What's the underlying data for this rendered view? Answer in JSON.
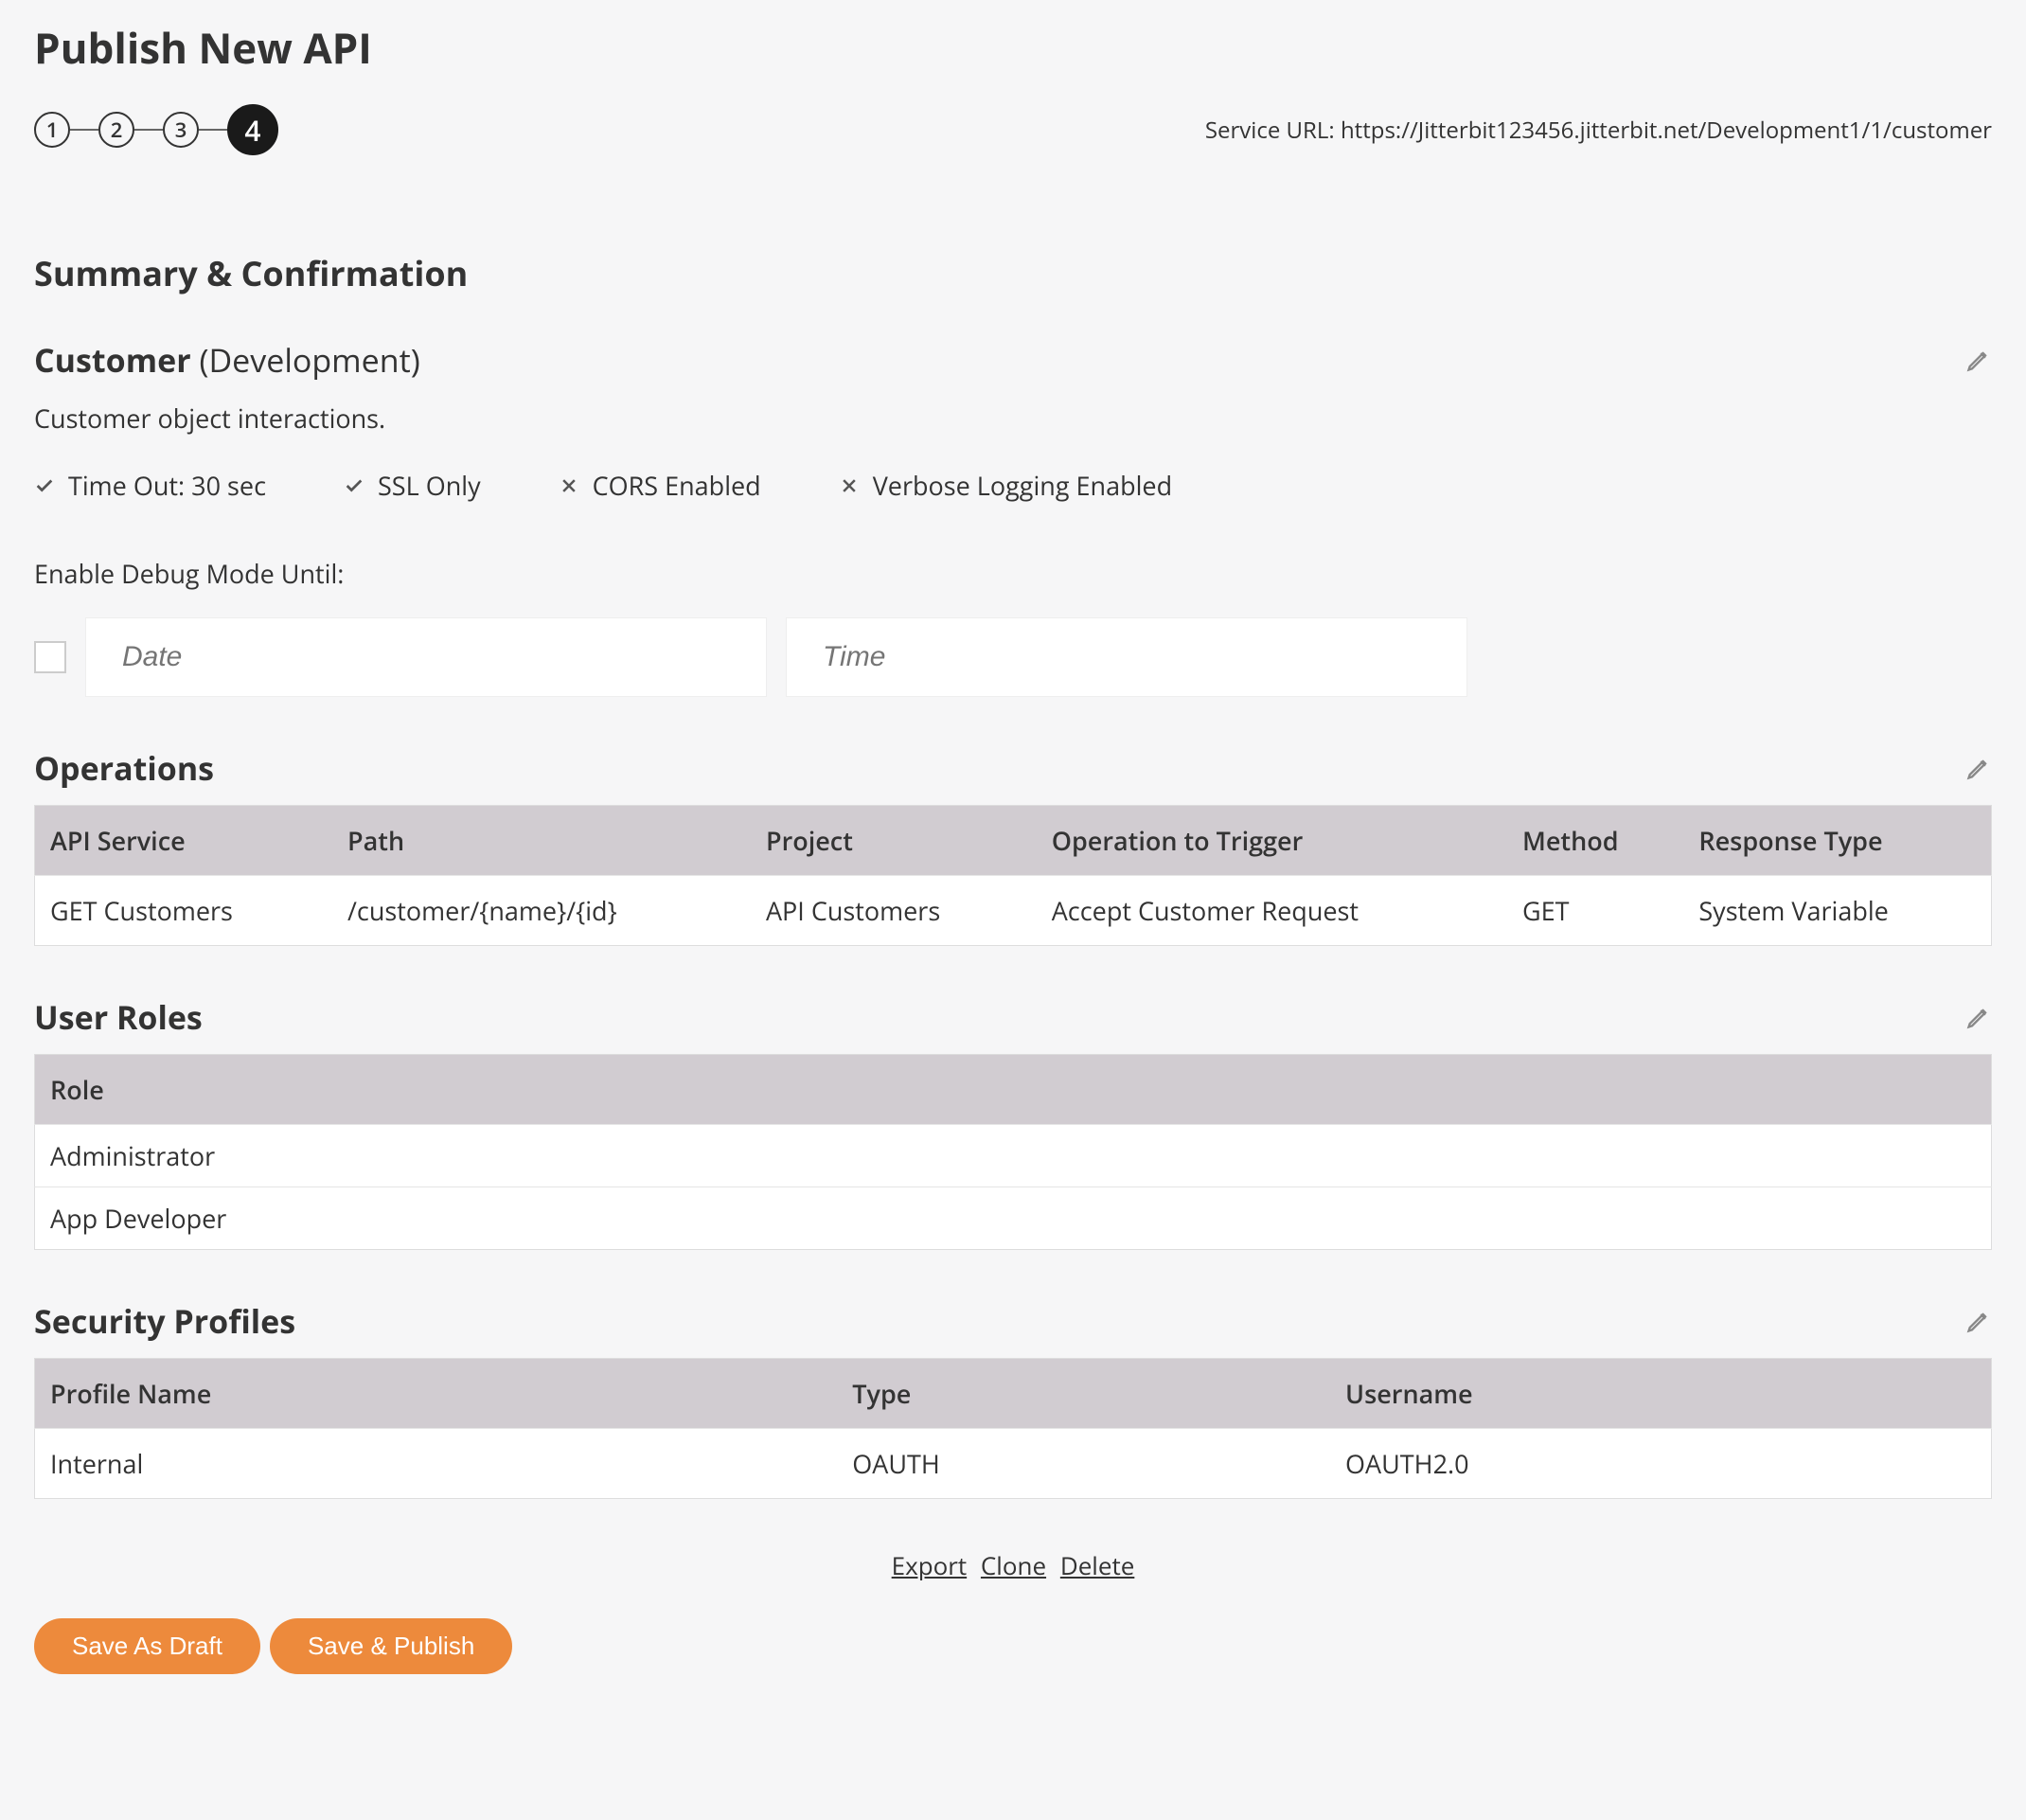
{
  "page_title": "Publish New API",
  "stepper": {
    "steps": [
      "1",
      "2",
      "3",
      "4"
    ],
    "active": 4
  },
  "service_url_label": "Service URL: ",
  "service_url": "https://Jitterbit123456.jitterbit.net/Development1/1/customer",
  "summary_heading": "Summary & Confirmation",
  "api": {
    "name": "Customer",
    "environment": "(Development)",
    "description": "Customer object interactions."
  },
  "settings": [
    {
      "enabled": true,
      "label": "Time Out: 30 sec"
    },
    {
      "enabled": true,
      "label": "SSL Only"
    },
    {
      "enabled": false,
      "label": "CORS Enabled"
    },
    {
      "enabled": false,
      "label": "Verbose Logging Enabled"
    }
  ],
  "debug": {
    "label": "Enable Debug Mode Until:",
    "date_placeholder": "Date",
    "time_placeholder": "Time"
  },
  "operations": {
    "heading": "Operations",
    "columns": [
      "API Service",
      "Path",
      "Project",
      "Operation to Trigger",
      "Method",
      "Response Type"
    ],
    "rows": [
      [
        "GET Customers",
        "/customer/{name}/{id}",
        "API Customers",
        "Accept Customer Request",
        "GET",
        "System Variable"
      ]
    ]
  },
  "roles": {
    "heading": "User Roles",
    "columns": [
      "Role"
    ],
    "rows": [
      [
        "Administrator"
      ],
      [
        "App Developer"
      ]
    ]
  },
  "security": {
    "heading": "Security Profiles",
    "columns": [
      "Profile Name",
      "Type",
      "Username"
    ],
    "rows": [
      [
        "Internal",
        "OAUTH",
        "OAUTH2.0"
      ]
    ]
  },
  "footer_links": {
    "export": "Export",
    "clone": "Clone",
    "delete": "Delete"
  },
  "buttons": {
    "save_draft": "Save As Draft",
    "save_publish": "Save & Publish"
  }
}
